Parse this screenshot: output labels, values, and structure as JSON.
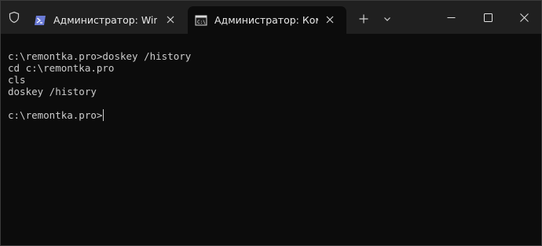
{
  "titlebar": {
    "tabs": [
      {
        "title": "Администратор: Windo",
        "icon": "powershell-icon",
        "active": false
      },
      {
        "title": "Администратор: Кома",
        "icon": "command-prompt-icon",
        "active": true
      }
    ]
  },
  "console": {
    "lines": [
      "c:\\remontka.pro>doskey /history",
      "cd c:\\remontka.pro",
      "cls",
      "doskey /history",
      "",
      "c:\\remontka.pro>"
    ]
  },
  "colors": {
    "titlebar_bg": "#202020",
    "console_bg": "#0c0c0c",
    "console_text": "#cccccc",
    "powershell_accent": "#6b7bd6"
  }
}
